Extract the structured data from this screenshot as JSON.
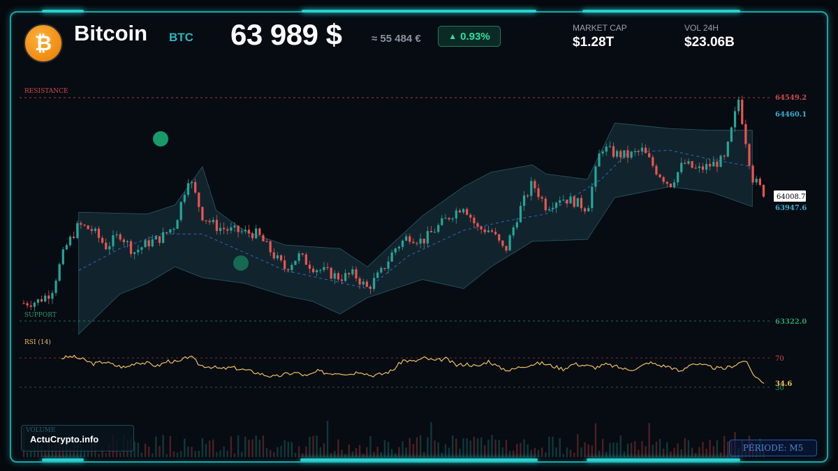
{
  "header": {
    "coin_name": "Bitcoin",
    "coin_symbol": "BTC",
    "logo_glyph": "₿",
    "price": "63 989 $",
    "price_eur": "≈ 55 484 €",
    "change_arrow": "▲",
    "change": "0.93%",
    "market_cap_label": "MARKET CAP",
    "market_cap_value": "$1.28T",
    "volume_label": "VOL 24H",
    "volume_value": "$23.06B"
  },
  "footer": {
    "brand": "ActuCrypto.info",
    "volume_label": "VOLUME",
    "period": "PÉRIODE: M5"
  },
  "colors": {
    "up": "#26a69a",
    "down": "#ef5350",
    "accent": "#2bd0d0",
    "resistance": "#d04a4a",
    "support": "#2a9d6a",
    "rsi": "#f0c060",
    "band_mid": "#3a6ad8",
    "band_fill": "#1a3a44"
  },
  "chart_data": {
    "type": "line",
    "title": "",
    "ylim": [
      63150,
      64650
    ],
    "resistance": {
      "label": "RESISTANCE",
      "value": 64549.2,
      "value_label": "64549.2"
    },
    "support": {
      "label": "SUPPORT",
      "value": 63322.0,
      "value_label": "63322.0"
    },
    "upper_band_label": "64460.1",
    "lower_band_label": "63947.6",
    "current_price_label": "64008.7",
    "series": [
      {
        "x": [
          0,
          5,
          10,
          15,
          20,
          25,
          30,
          35,
          40,
          45,
          50,
          55,
          60,
          65,
          70,
          75,
          80,
          85,
          90,
          95,
          100,
          105,
          110,
          115,
          120,
          125,
          130,
          135,
          140,
          145,
          150,
          155,
          160,
          165,
          170,
          175,
          180,
          185,
          190,
          195,
          200,
          205,
          210,
          215,
          220,
          225,
          230,
          235,
          240,
          245,
          250,
          255,
          260,
          265,
          270
        ],
        "y": [
          63420,
          63430,
          63480,
          63720,
          63850,
          63820,
          63730,
          63800,
          63700,
          63750,
          63780,
          63850,
          64120,
          63900,
          63840,
          63820,
          63810,
          63800,
          63700,
          63610,
          63680,
          63620,
          63590,
          63560,
          63580,
          63500,
          63590,
          63720,
          63790,
          63760,
          63830,
          63900,
          63960,
          63830,
          63820,
          63700,
          63920,
          64080,
          63950,
          64000,
          63980,
          63940,
          64280,
          64240,
          64230,
          64260,
          64150,
          64070,
          64190,
          64150,
          64180,
          64210,
          64540,
          64110,
          64010
        ]
      },
      {
        "name": "Upper band",
        "x": [
          20,
          45,
          55,
          65,
          70,
          80,
          95,
          115,
          125,
          145,
          160,
          170,
          185,
          190,
          205,
          215,
          235,
          250,
          265
        ],
        "y": [
          63920,
          63910,
          63960,
          64170,
          63930,
          63820,
          63740,
          63720,
          63620,
          63900,
          64060,
          64140,
          64180,
          64130,
          64100,
          64410,
          64380,
          64370,
          64370
        ]
      },
      {
        "name": "Lower band",
        "x": [
          20,
          35,
          45,
          55,
          65,
          80,
          95,
          105,
          115,
          125,
          145,
          160,
          170,
          185,
          205,
          215,
          235,
          250,
          265
        ],
        "y": [
          63250,
          63470,
          63530,
          63620,
          63560,
          63530,
          63460,
          63430,
          63360,
          63450,
          63550,
          63500,
          63620,
          63760,
          63770,
          64000,
          64060,
          64030,
          63950
        ]
      },
      {
        "name": "Middle band",
        "x": [
          20,
          35,
          50,
          65,
          80,
          95,
          110,
          125,
          140,
          160,
          175,
          190,
          210,
          220,
          235,
          250,
          265
        ],
        "y": [
          63600,
          63720,
          63800,
          63800,
          63700,
          63600,
          63550,
          63500,
          63680,
          63820,
          63870,
          63910,
          64100,
          64250,
          64260,
          64210,
          64170
        ]
      }
    ],
    "rsi": {
      "label": "RSI (14)",
      "current_label": "34.6",
      "level_70_label": "70",
      "level_30_label": "30",
      "x": [
        0,
        4,
        8,
        12,
        16,
        20,
        24,
        28,
        32,
        36,
        40,
        44,
        48,
        52,
        56,
        60,
        64,
        68,
        72,
        76,
        80,
        84,
        88,
        92,
        96,
        100,
        104,
        108,
        112,
        116,
        120,
        124,
        128,
        132,
        136,
        140,
        144,
        148,
        152,
        156,
        160,
        164,
        168,
        172,
        176,
        180,
        184,
        188,
        192,
        196,
        200,
        204,
        208,
        212,
        216,
        220,
        224,
        228,
        232,
        236,
        240,
        244,
        248,
        252,
        256,
        260,
        264
      ],
      "y": [
        70,
        72,
        68,
        62,
        65,
        60,
        57,
        64,
        63,
        59,
        66,
        64,
        73,
        60,
        58,
        55,
        57,
        54,
        51,
        47,
        44,
        48,
        50,
        45,
        52,
        49,
        50,
        48,
        52,
        46,
        48,
        53,
        67,
        65,
        70,
        66,
        69,
        60,
        62,
        58,
        66,
        57,
        53,
        58,
        61,
        63,
        59,
        55,
        62,
        60,
        57,
        61,
        58,
        54,
        56,
        64,
        60,
        58,
        51,
        63,
        60,
        57,
        55,
        60,
        67,
        44,
        35
      ]
    },
    "volume": {
      "label": "VOLUME"
    }
  }
}
